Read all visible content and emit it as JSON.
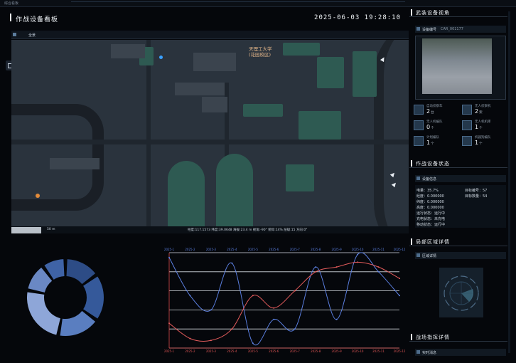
{
  "window": {
    "top_label": "综合看板"
  },
  "header": {
    "title": "作战设备看板",
    "datetime": "2025-06-03 19:28:10"
  },
  "map": {
    "tab_label": "全景",
    "campus_label_line1": "天理工大学",
    "campus_label_line2": "(花园校区)",
    "scale_label": "50 m",
    "status_stats": "经度:117.1573  纬度:39.0648  海拔:23.4 m  视角:-90°  俯仰:14%  层级:15  方向:0°"
  },
  "right": {
    "camera_section_title": "武装设备视角",
    "camera_subhead_label": "设备编号",
    "camera_subhead_value": "CAR_001177",
    "devices": [
      {
        "label": "自动侦察车",
        "value": "2",
        "unit": "台",
        "icon": "vehicle-icon"
      },
      {
        "label": "无人侦察机",
        "value": "2",
        "unit": "架",
        "icon": "drone-icon"
      },
      {
        "label": "无人机编队",
        "value": "0",
        "unit": "个",
        "icon": "fleet-icon"
      },
      {
        "label": "无人机机库",
        "value": "1",
        "unit": "个",
        "icon": "hangar-icon"
      },
      {
        "label": "计划编队",
        "value": "1",
        "unit": "个",
        "icon": "plan-icon"
      },
      {
        "label": "机器狗编队",
        "value": "1",
        "unit": "个",
        "icon": "robot-dog-icon"
      }
    ],
    "status_section_title": "作战设备状态",
    "status_subhead_label": "设备信息",
    "status_rows": [
      "电量：35.7%",
      "经度：0.000000",
      "纬度：0.000000",
      "高度：0.000000",
      "运行状态：运行中",
      "充电状态：未充电",
      "移动状态：运行中"
    ],
    "status_right_rows": [
      "目标编号：57",
      "目标数量：54"
    ],
    "area_section_title": "局部区域详情",
    "area_subhead_label": "区域详情",
    "log_section_title": "战场指挥详情",
    "log_subhead_label": "实时消息"
  },
  "donut_data": [
    15,
    20,
    18,
    25,
    12,
    10
  ],
  "chart_data": {
    "type": "line",
    "x": [
      "2025-1",
      "2025-2",
      "2025-3",
      "2025-4",
      "2025-5",
      "2025-6",
      "2025-7",
      "2025-8",
      "2025-9",
      "2025-10",
      "2025-11",
      "2025-12"
    ],
    "series": [
      {
        "values": [
          95,
          55,
          40,
          89,
          5,
          30,
          20,
          85,
          30,
          98,
          80,
          55
        ],
        "color": "#5b7fe0"
      },
      {
        "values": [
          26,
          10,
          8,
          20,
          55,
          42,
          60,
          80,
          85,
          90,
          85,
          73
        ],
        "color": "#e25b5b"
      }
    ],
    "ylim": [
      0,
      100
    ],
    "colors": {
      "grid": "#d8dde3",
      "axis": "#d94a4a"
    }
  }
}
